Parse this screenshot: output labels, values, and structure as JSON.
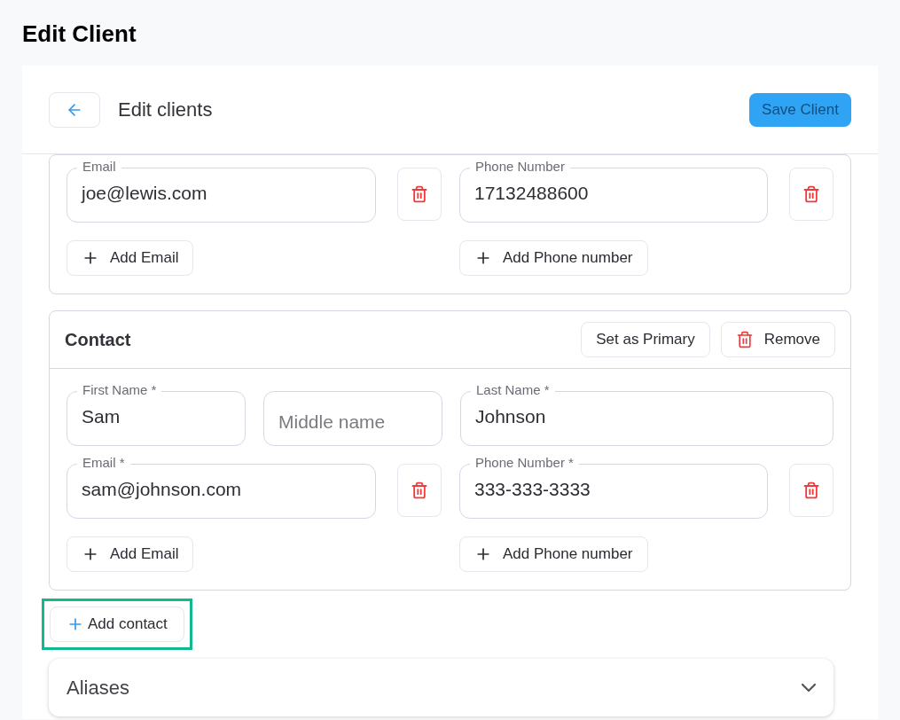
{
  "page_title": "Edit Client",
  "header": {
    "title": "Edit clients",
    "save_button": {
      "label": "Save Client",
      "disabled": true
    }
  },
  "contacts": [
    {
      "emails": [
        {
          "label": "Email",
          "value": "joe@lewis.com"
        }
      ],
      "phones": [
        {
          "label": "Phone Number",
          "value": "17132488600"
        }
      ],
      "add_email": "Add Email",
      "add_phone": "Add Phone number"
    },
    {
      "title": "Contact",
      "actions": {
        "primary": "Set as Primary",
        "remove": "Remove"
      },
      "name_fields": [
        {
          "label": "First Name *",
          "value": "Sam"
        },
        {
          "placeholder": "Middle name"
        },
        {
          "label": "Last Name *",
          "value": "Johnson"
        }
      ],
      "emails": [
        {
          "label": "Email *",
          "value": "sam@johnson.com"
        }
      ],
      "phones": [
        {
          "label": "Phone Number *",
          "value": "333-333-3333"
        }
      ],
      "add_email": "Add Email",
      "add_phone": "Add Phone number"
    }
  ],
  "add_contact": {
    "label": "Add contact",
    "highlighted": true
  },
  "aliases": {
    "label": "Aliases",
    "expanded": false
  }
}
